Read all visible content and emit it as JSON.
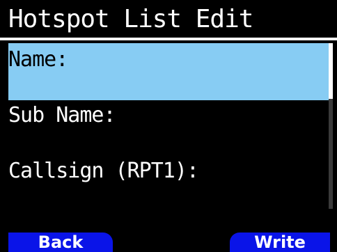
{
  "screen": {
    "title": "Hotspot List Edit"
  },
  "fields": [
    {
      "label": "Name:",
      "value": "",
      "selected": true
    },
    {
      "label": "Sub Name:",
      "value": "",
      "selected": false
    },
    {
      "label": "Callsign (RPT1):",
      "value": "",
      "selected": false
    }
  ],
  "softkeys": {
    "left_label": "Back",
    "right_label": "Write"
  },
  "colors": {
    "background": "#000000",
    "selection": "#87ccf3",
    "softkey": "#0a14e8",
    "text": "#ffffff"
  }
}
